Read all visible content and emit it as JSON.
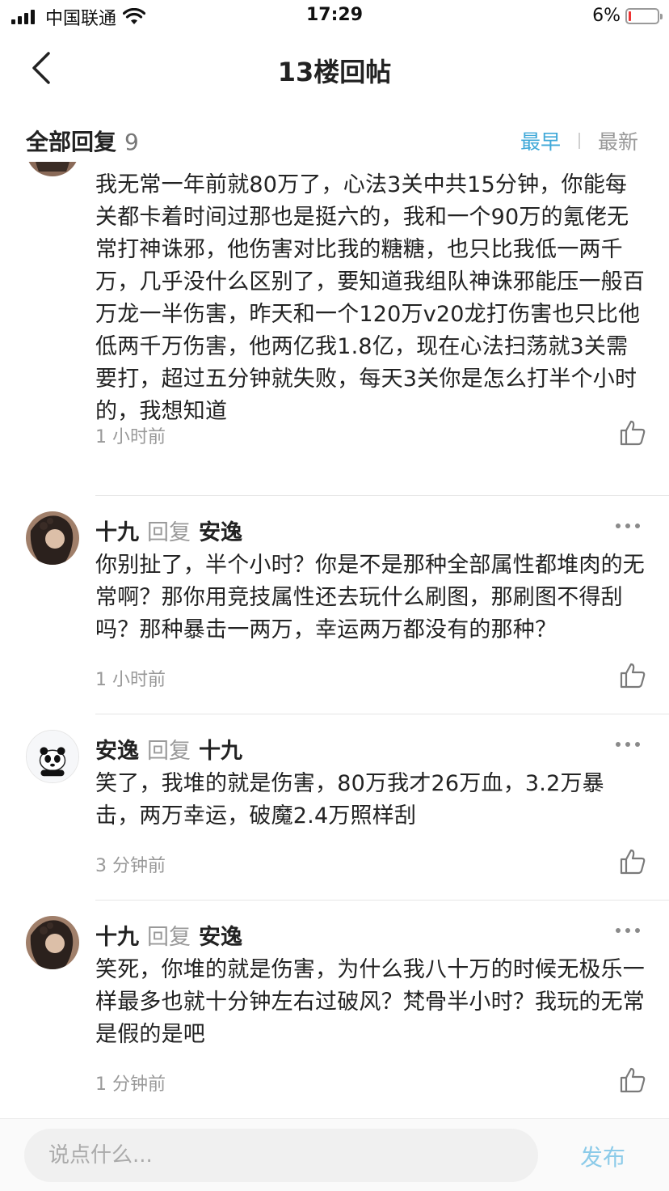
{
  "status_bar": {
    "carrier": "中国联通",
    "time": "17:29",
    "battery": "6%"
  },
  "nav": {
    "title": "13楼回帖"
  },
  "reply_header": {
    "title": "全部回复",
    "count": "9",
    "sort_earliest": "最早",
    "sort_latest": "最新",
    "active_color": "#3fa8d8"
  },
  "comments": [
    {
      "body": "我无常一年前就80万了，心法3关中共15分钟，你能每关都卡着时间过那也是挺六的，我和一个90万的氪佬无常打神诛邪，他伤害对比我的糖糖，也只比我低一两千万，几乎没什么区别了，要知道我组队神诛邪能压一般百万龙一半伤害，昨天和一个120万v20龙打伤害也只比他低两千万伤害，他两亿我1.8亿，现在心法扫荡就3关需要打，超过五分钟就失败，每天3关你是怎么打半个小时的，我想知道",
      "time": "1 小时前"
    },
    {
      "author": "十九",
      "reply_word": "回复",
      "target": "安逸",
      "body": "你别扯了，半个小时？你是不是那种全部属性都堆肉的无常啊？那你用竞技属性还去玩什么刷图，那刷图不得刮吗？那种暴击一两万，幸运两万都没有的那种？",
      "time": "1 小时前"
    },
    {
      "author": "安逸",
      "reply_word": "回复",
      "target": "十九",
      "body": "笑了，我堆的就是伤害，80万我才26万血，3.2万暴击，两万幸运，破魔2.4万照样刮",
      "time": "3 分钟前"
    },
    {
      "author": "十九",
      "reply_word": "回复",
      "target": "安逸",
      "body": "笑死，你堆的就是伤害，为什么我八十万的时候无极乐一样最多也就十分钟左右过破风？梵骨半小时？我玩的无常是假的是吧",
      "time": "1 分钟前"
    }
  ],
  "bottom_bar": {
    "input_placeholder": "说点什么...",
    "publish": "发布"
  }
}
